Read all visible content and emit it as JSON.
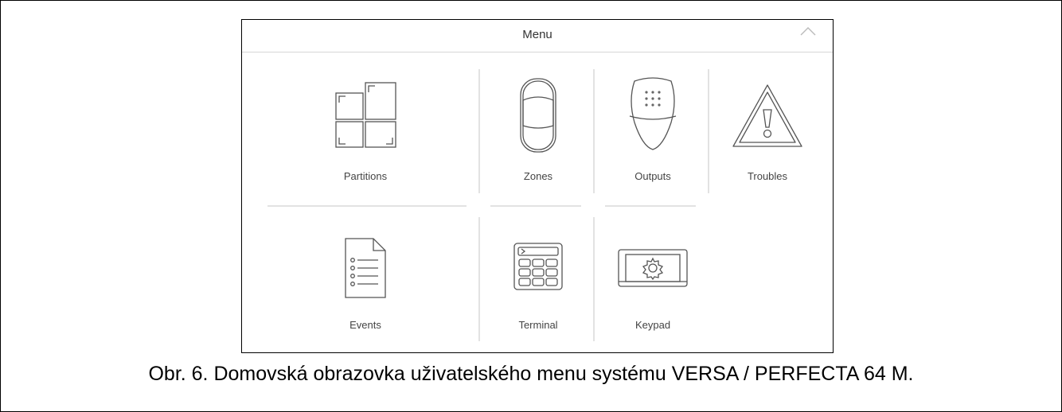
{
  "header": {
    "title": "Menu",
    "collapse_icon": "chevron-up-icon"
  },
  "tiles": [
    {
      "label": "Partitions",
      "icon": "partitions-icon"
    },
    {
      "label": "Zones",
      "icon": "zones-detector-icon"
    },
    {
      "label": "Outputs",
      "icon": "outputs-icon"
    },
    {
      "label": "Troubles",
      "icon": "troubles-warning-icon"
    },
    {
      "label": "Events",
      "icon": "events-document-icon"
    },
    {
      "label": "Terminal",
      "icon": "terminal-keypad-icon"
    },
    {
      "label": "Keypad",
      "icon": "keypad-screen-icon"
    }
  ],
  "caption": "Obr. 6. Domovská obrazovka uživatelského menu systému VERSA / PERFECTA 64 M."
}
